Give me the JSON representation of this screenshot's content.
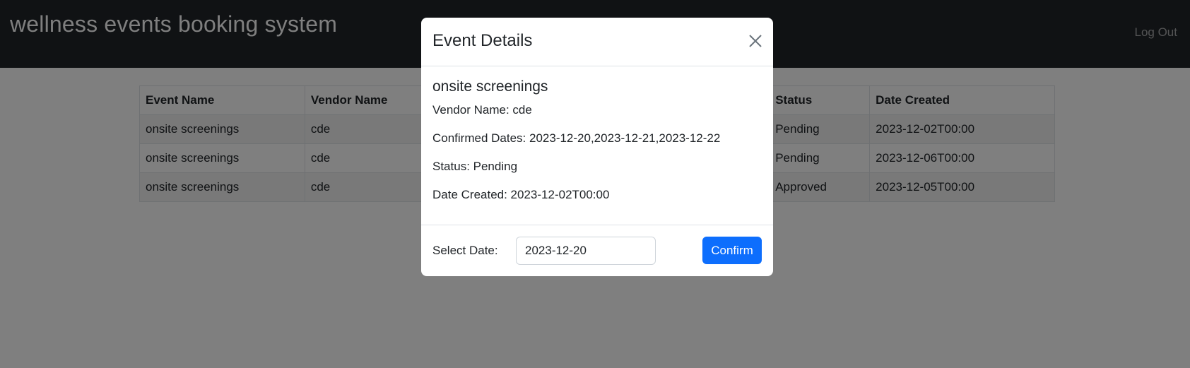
{
  "navbar": {
    "brand": "wellness events booking system",
    "logout_label": "Log Out"
  },
  "table": {
    "headers": [
      "Event Name",
      "Vendor Name",
      "",
      "",
      "Status",
      "Date Created"
    ],
    "rows": [
      [
        "onsite screenings",
        "cde",
        "",
        "",
        "Pending",
        "2023-12-02T00:00"
      ],
      [
        "onsite screenings",
        "cde",
        "",
        "",
        "Pending",
        "2023-12-06T00:00"
      ],
      [
        "onsite screenings",
        "cde",
        "",
        "",
        "Approved",
        "2023-12-05T00:00"
      ]
    ]
  },
  "modal": {
    "title": "Event Details",
    "close_icon": "close-icon",
    "event_name": "onsite screenings",
    "vendor_line": "Vendor Name: cde",
    "confirmed_dates_line": "Confirmed Dates: 2023-12-20,2023-12-21,2023-12-22",
    "status_line": "Status: Pending",
    "date_created_line": "Date Created: 2023-12-02T00:00",
    "select_date_label": "Select Date:",
    "select_date_value": "2023-12-20",
    "confirm_label": "Confirm"
  },
  "colors": {
    "navbar_bg": "#212529",
    "primary": "#0d6efd",
    "backdrop": "rgba(0,0,0,0.5)"
  }
}
